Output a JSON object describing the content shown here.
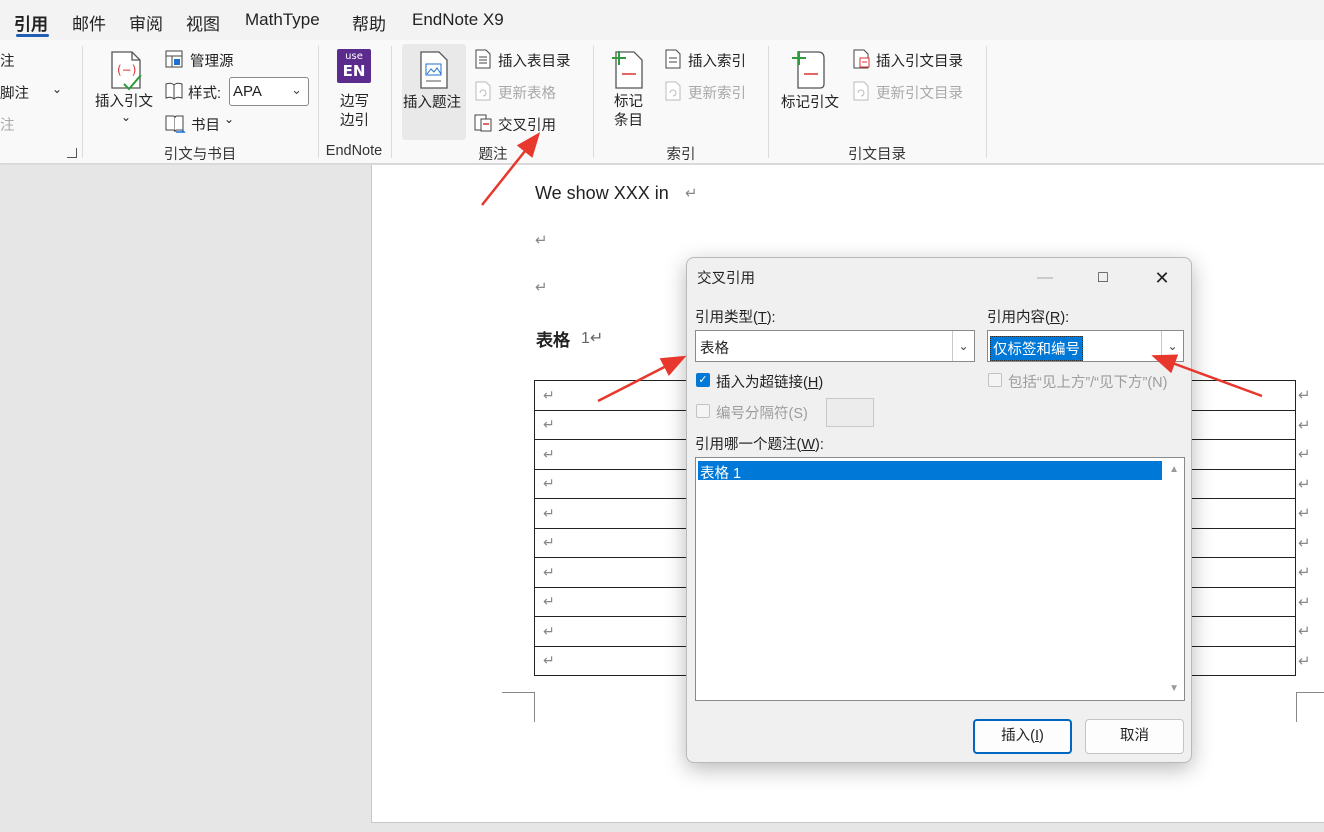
{
  "tabs": [
    "引用",
    "邮件",
    "审阅",
    "视图",
    "MathType",
    "帮助",
    "EndNote X9"
  ],
  "active_tab": "引用",
  "ribbon": {
    "footnotes_partial": [
      "注",
      "脚注",
      "注"
    ],
    "insert_citation": "插入引文",
    "manage_sources": "管理源",
    "style_label": "样式:",
    "style_value": "APA",
    "bibliography": "书目",
    "group_citations": "引文与书目",
    "endnote_btn": "边写\n边引",
    "endnote_btn_l1": "边写",
    "endnote_btn_l2": "边引",
    "group_endnote": "EndNote",
    "insert_caption": "插入题注",
    "insert_table_of_figures": "插入表目录",
    "update_table": "更新表格",
    "cross_reference": "交叉引用",
    "group_captions": "题注",
    "mark_entry_l1": "标记",
    "mark_entry_l2": "条目",
    "insert_index": "插入索引",
    "update_index": "更新索引",
    "group_index": "索引",
    "mark_citation": "标记引文",
    "insert_toa": "插入引文目录",
    "update_toa": "更新引文目录",
    "group_toa": "引文目录",
    "endnote_logo_top": "use",
    "endnote_logo_bottom": "EN"
  },
  "document": {
    "line1": "We show XXX in",
    "para_mark": "↵",
    "caption_label": "表格",
    "caption_num": "1↵",
    "table_rows": 10
  },
  "dialog": {
    "title": "交叉引用",
    "ref_type_label": "引用类型(",
    "ref_type_key": "T",
    "ref_type_tail": "):",
    "ref_type_value": "表格",
    "ref_content_label": "引用内容(",
    "ref_content_key": "R",
    "ref_content_tail": "):",
    "ref_content_value": "仅标签和编号",
    "insert_hyperlink_label": "插入为超链接(",
    "insert_hyperlink_key": "H",
    "insert_hyperlink_tail": ")",
    "insert_hyperlink_checked": true,
    "include_above_below": "包括“见上方”/“见下方”(N)",
    "separate_numbers": "编号分隔符(S)",
    "which_caption_label": "引用哪一个题注(",
    "which_caption_key": "W",
    "which_caption_tail": "):",
    "captions": [
      "表格 1"
    ],
    "insert_button": "插入(",
    "insert_button_key": "I",
    "insert_button_tail": ")",
    "cancel_button": "取消"
  },
  "colors": {
    "accent": "#0078d7",
    "tab_underline": "#1f5eb3",
    "annotation_arrow": "#e8372c"
  }
}
